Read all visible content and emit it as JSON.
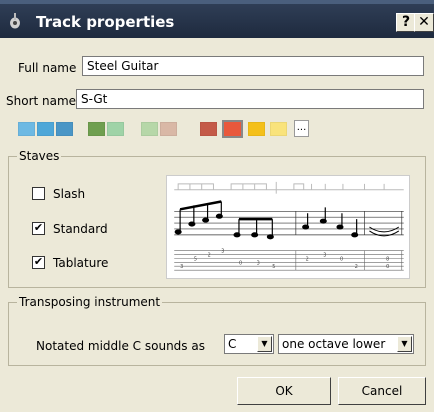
{
  "window": {
    "title": "Track properties",
    "help_label": "?",
    "close_label": "✕"
  },
  "form": {
    "full_name_label": "Full name",
    "full_name_value": "Steel Guitar",
    "short_name_label": "Short name",
    "short_name_value": "S-Gt"
  },
  "colors": {
    "swatches": [
      "#6db9e3",
      "#4ea7d8",
      "#4a96c6",
      "#6f9f4f",
      "#9fd3a7",
      "#b6d7a8",
      "#d9b8a6",
      "#c45a48",
      "#e8583c",
      "#f4c01a",
      "#f9e37b"
    ],
    "selected_index": 8,
    "more_label": "..."
  },
  "staves": {
    "group_title": "Staves",
    "slash": {
      "label": "Slash",
      "checked": false
    },
    "standard": {
      "label": "Standard",
      "checked": true
    },
    "tablature": {
      "label": "Tablature",
      "checked": true
    }
  },
  "transposing": {
    "group_title": "Transposing instrument",
    "label": "Notated middle C sounds as",
    "note_value": "C",
    "octave_value": "one octave lower"
  },
  "buttons": {
    "ok": "OK",
    "cancel": "Cancel"
  },
  "icons": {
    "dropdown": "▼",
    "check": "✔"
  }
}
